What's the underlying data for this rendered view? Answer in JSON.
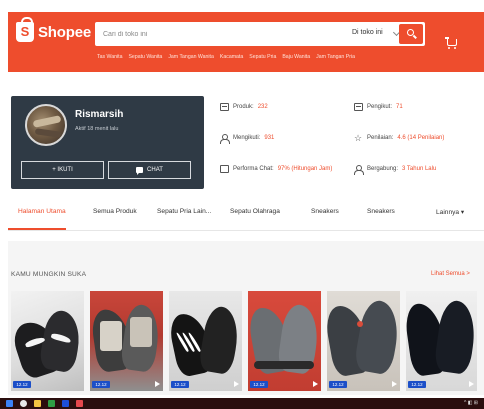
{
  "header": {
    "logo_text": "Shopee",
    "search_placeholder": "Cari di toko ini",
    "search_scope": "Di toko ini",
    "keywords": [
      "Tas Wanita",
      "Sepatu Wanita",
      "Jam Tangan Wanita",
      "Kacamata",
      "Sepatu Pria",
      "Baju Wanita",
      "Jam Tangan Pria"
    ],
    "accent_color": "#ee4d2d"
  },
  "shop": {
    "name": "Rismarsih",
    "active_status": "Aktif 18 menit lalu",
    "follow_label": "+ IKUTI",
    "chat_label": "CHAT"
  },
  "stats": {
    "produk": {
      "label": "Produk:",
      "value": "232",
      "icon": "box-icon"
    },
    "pengikut": {
      "label": "Pengikut:",
      "value": "71",
      "icon": "box-icon"
    },
    "mengikuti": {
      "label": "Mengikuti:",
      "value": "931",
      "icon": "user-icon"
    },
    "penilaian": {
      "label": "Penilaian:",
      "value": "4.6 (14 Penilaian)",
      "icon": "star-icon"
    },
    "performa": {
      "label": "Performa Chat:",
      "value": "97% (Hitungan Jam)",
      "icon": "chat-icon"
    },
    "bergabung": {
      "label": "Bergabung:",
      "value": "3 Tahun Lalu",
      "icon": "user-icon"
    }
  },
  "tabs": [
    "Halaman Utama",
    "Semua Produk",
    "Sepatu Pria Lain...",
    "Sepatu Olahraga",
    "Sneakers",
    "Sneakers",
    "Lainnya ▾"
  ],
  "recommend": {
    "title": "KAMU MUNGKIN SUKA",
    "see_all": "Lihat Semua >"
  },
  "products": [
    {
      "badge": "12.12",
      "has_video": false
    },
    {
      "badge": "12.12",
      "has_video": true
    },
    {
      "badge": "12.12",
      "has_video": true
    },
    {
      "badge": "12.12",
      "has_video": true
    },
    {
      "badge": "12.12",
      "has_video": true
    },
    {
      "badge": "12.12",
      "has_video": true
    }
  ]
}
